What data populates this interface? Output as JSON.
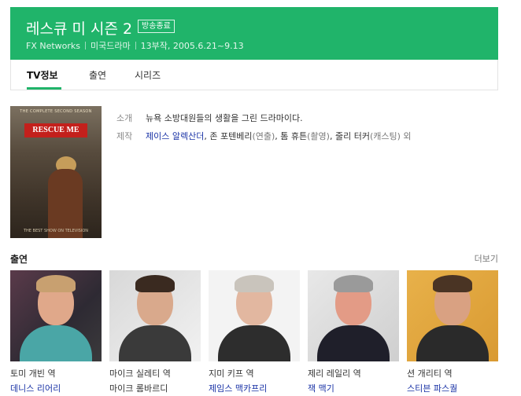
{
  "header": {
    "title": "레스큐 미 시즌 2",
    "status_badge": "방송종료",
    "network": "FX Networks",
    "genre": "미국드라마",
    "episodes_dates": "13부작, 2005.6.21~9.13"
  },
  "tabs": [
    {
      "label": "TV정보",
      "active": true
    },
    {
      "label": "출연",
      "active": false
    },
    {
      "label": "시리즈",
      "active": false
    }
  ],
  "poster": {
    "top_text": "THE COMPLETE SECOND SEASON",
    "logo_text": "RESCUE ME",
    "bottom_text": "THE BEST SHOW ON TELEVISION"
  },
  "info": {
    "intro_label": "소개",
    "intro_text": "뉴욕 소방대원들의 생활을 그린 드라마이다.",
    "production_label": "제작",
    "production": [
      {
        "name": "제이스 알렉산더",
        "role": "",
        "link": true
      },
      {
        "name": "존 포텐베리",
        "role": "(연출)",
        "link": false
      },
      {
        "name": "톰 휴튼",
        "role": "(촬영)",
        "link": false
      },
      {
        "name": "줄리 터커",
        "role": "(캐스팅) 외",
        "link": false
      }
    ]
  },
  "cast_section": {
    "heading": "출연",
    "more_label": "더보기",
    "members": [
      {
        "role": "토미 개빈 역",
        "actor": "데니스 리어리",
        "link": true
      },
      {
        "role": "마이크 실레티 역",
        "actor": "마이크 롬바르디",
        "link": false
      },
      {
        "role": "지미 키프 역",
        "actor": "제임스 맥카프리",
        "link": true
      },
      {
        "role": "제리 레일리 역",
        "actor": "잭 맥기",
        "link": true
      },
      {
        "role": "션 개리티 역",
        "actor": "스티븐 파스퀄",
        "link": true
      }
    ]
  },
  "colors": {
    "accent": "#20b46a",
    "link": "#1a33a6"
  }
}
